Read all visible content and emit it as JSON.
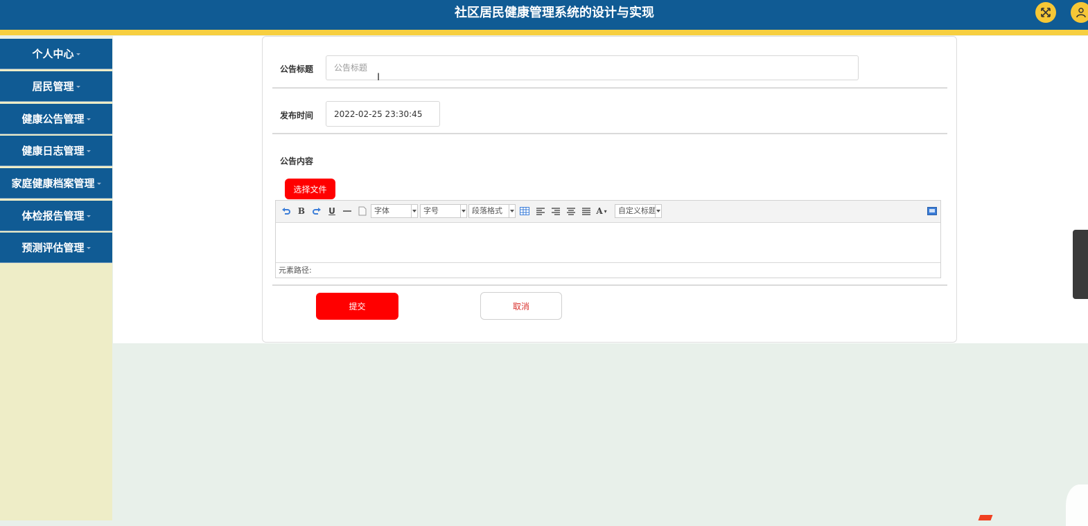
{
  "header": {
    "title": "社区居民健康管理系统的设计与实现"
  },
  "sidebar": {
    "items": [
      {
        "label": "个人中心"
      },
      {
        "label": "居民管理"
      },
      {
        "label": "健康公告管理"
      },
      {
        "label": "健康日志管理"
      },
      {
        "label": "家庭健康档案管理"
      },
      {
        "label": "体检报告管理"
      },
      {
        "label": "预测评估管理"
      }
    ]
  },
  "form": {
    "title_label": "公告标题",
    "title_placeholder": "公告标题",
    "title_value": "",
    "time_label": "发布时间",
    "time_value": "2022-02-25 23:30:45",
    "content_label": "公告内容",
    "choose_file": "选择文件",
    "submit": "提交",
    "cancel": "取消"
  },
  "editor": {
    "font_select": "字体",
    "size_select": "字号",
    "paragraph_select": "段落格式",
    "custom_title_select": "自定义标题",
    "element_path": "元素路径:",
    "bold": "B",
    "underline": "U",
    "font_color": "A"
  },
  "colors": {
    "header_bg": "#105b94",
    "accent_yellow": "#f7cf40",
    "button_red": "#ff0000"
  }
}
